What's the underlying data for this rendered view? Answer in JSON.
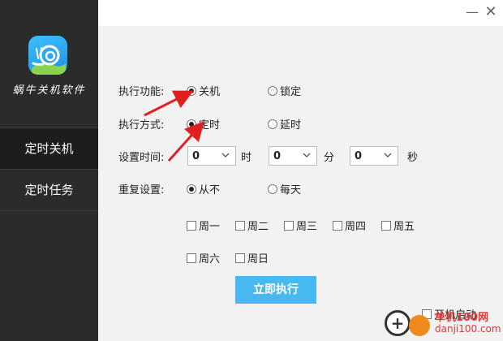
{
  "sidebar": {
    "app_name": "蜗牛关机软件",
    "items": [
      {
        "label": "定时关机"
      },
      {
        "label": "定时任务"
      }
    ]
  },
  "titlebar": {
    "min_glyph": "—",
    "close_glyph": "✕"
  },
  "form": {
    "function_label": "执行功能:",
    "function_options": [
      "关机",
      "锁定"
    ],
    "mode_label": "执行方式:",
    "mode_options": [
      "定时",
      "延时"
    ],
    "time_label": "设置时间:",
    "hour_value": "0",
    "hour_unit": "时",
    "minute_value": "0",
    "minute_unit": "分",
    "second_value": "0",
    "second_unit": "秒",
    "repeat_label": "重复设置:",
    "repeat_options": [
      "从不",
      "每天"
    ],
    "weekdays": [
      "周一",
      "周二",
      "周三",
      "周四",
      "周五",
      "周六",
      "周日"
    ]
  },
  "actions": {
    "execute_label": "立即执行",
    "autostart_label": "开机启动"
  },
  "watermark": {
    "text": "单机100网",
    "url": "danji100.com"
  },
  "colors": {
    "sidebar_bg": "#2b2b2b",
    "content_bg": "#f2f2f2",
    "button_bg": "#47b9f0",
    "arrow": "#e02020"
  }
}
